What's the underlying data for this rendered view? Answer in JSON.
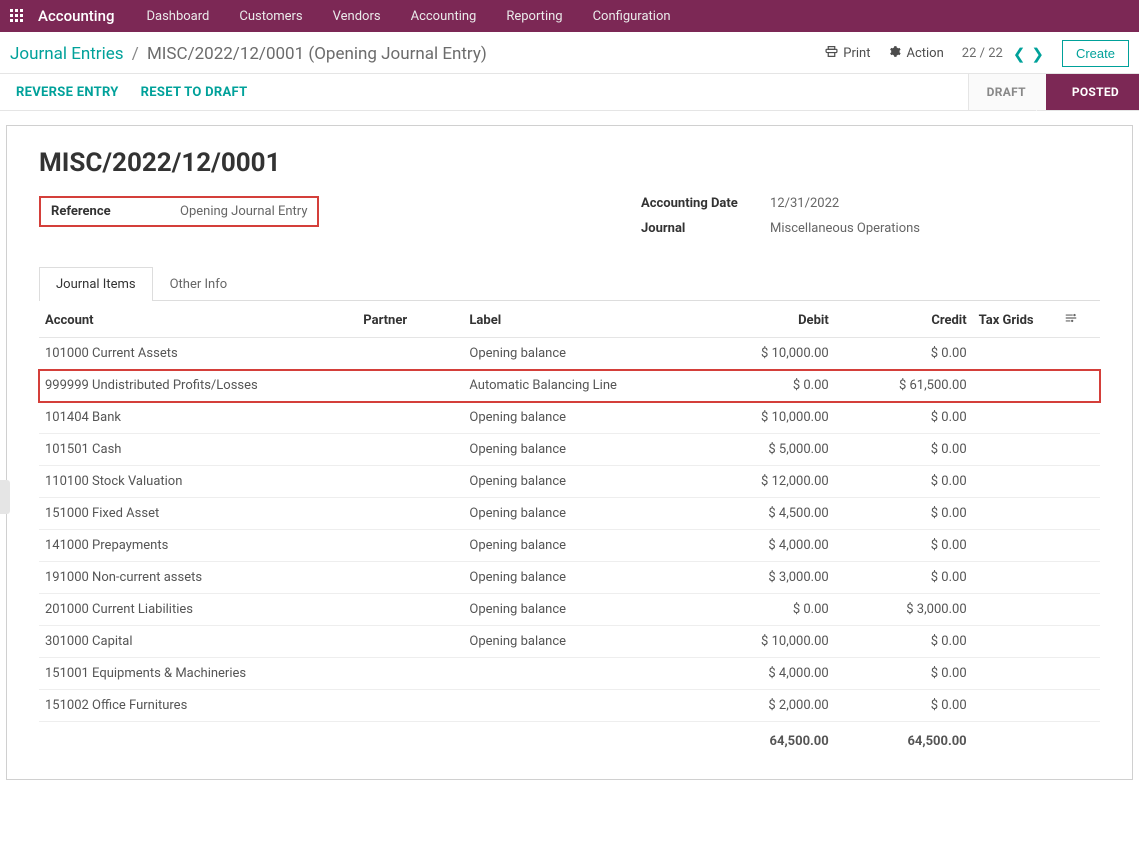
{
  "topnav": {
    "app_title": "Accounting",
    "items": [
      "Dashboard",
      "Customers",
      "Vendors",
      "Accounting",
      "Reporting",
      "Configuration"
    ]
  },
  "breadcrumb": {
    "root": "Journal Entries",
    "current": "MISC/2022/12/0001 (Opening Journal Entry)"
  },
  "header_actions": {
    "print": "Print",
    "action": "Action",
    "pager": "22 / 22",
    "create": "Create"
  },
  "statusbar": {
    "reverse": "REVERSE ENTRY",
    "reset": "RESET TO DRAFT",
    "stages": [
      "DRAFT",
      "POSTED"
    ],
    "active_stage": 1
  },
  "entry": {
    "title": "MISC/2022/12/0001",
    "reference_label": "Reference",
    "reference_value": "Opening Journal Entry",
    "accounting_date_label": "Accounting Date",
    "accounting_date_value": "12/31/2022",
    "journal_label": "Journal",
    "journal_value": "Miscellaneous Operations"
  },
  "tabs": {
    "journal_items": "Journal Items",
    "other_info": "Other Info"
  },
  "columns": {
    "account": "Account",
    "partner": "Partner",
    "label": "Label",
    "debit": "Debit",
    "credit": "Credit",
    "tax_grids": "Tax Grids"
  },
  "lines": [
    {
      "account": "101000 Current Assets",
      "partner": "",
      "label": "Opening balance",
      "debit": "$ 10,000.00",
      "credit": "$ 0.00",
      "highlight": false
    },
    {
      "account": "999999 Undistributed Profits/Losses",
      "partner": "",
      "label": "Automatic Balancing Line",
      "debit": "$ 0.00",
      "credit": "$ 61,500.00",
      "highlight": true
    },
    {
      "account": "101404 Bank",
      "partner": "",
      "label": "Opening balance",
      "debit": "$ 10,000.00",
      "credit": "$ 0.00",
      "highlight": false
    },
    {
      "account": "101501 Cash",
      "partner": "",
      "label": "Opening balance",
      "debit": "$ 5,000.00",
      "credit": "$ 0.00",
      "highlight": false
    },
    {
      "account": "110100 Stock Valuation",
      "partner": "",
      "label": "Opening balance",
      "debit": "$ 12,000.00",
      "credit": "$ 0.00",
      "highlight": false
    },
    {
      "account": "151000 Fixed Asset",
      "partner": "",
      "label": "Opening balance",
      "debit": "$ 4,500.00",
      "credit": "$ 0.00",
      "highlight": false
    },
    {
      "account": "141000 Prepayments",
      "partner": "",
      "label": "Opening balance",
      "debit": "$ 4,000.00",
      "credit": "$ 0.00",
      "highlight": false
    },
    {
      "account": "191000 Non-current assets",
      "partner": "",
      "label": "Opening balance",
      "debit": "$ 3,000.00",
      "credit": "$ 0.00",
      "highlight": false
    },
    {
      "account": "201000 Current Liabilities",
      "partner": "",
      "label": "Opening balance",
      "debit": "$ 0.00",
      "credit": "$ 3,000.00",
      "highlight": false
    },
    {
      "account": "301000 Capital",
      "partner": "",
      "label": "Opening balance",
      "debit": "$ 10,000.00",
      "credit": "$ 0.00",
      "highlight": false
    },
    {
      "account": "151001 Equipments & Machineries",
      "partner": "",
      "label": "",
      "debit": "$ 4,000.00",
      "credit": "$ 0.00",
      "highlight": false
    },
    {
      "account": "151002 Office Furnitures",
      "partner": "",
      "label": "",
      "debit": "$ 2,000.00",
      "credit": "$ 0.00",
      "highlight": false
    }
  ],
  "totals": {
    "debit": "64,500.00",
    "credit": "64,500.00"
  }
}
